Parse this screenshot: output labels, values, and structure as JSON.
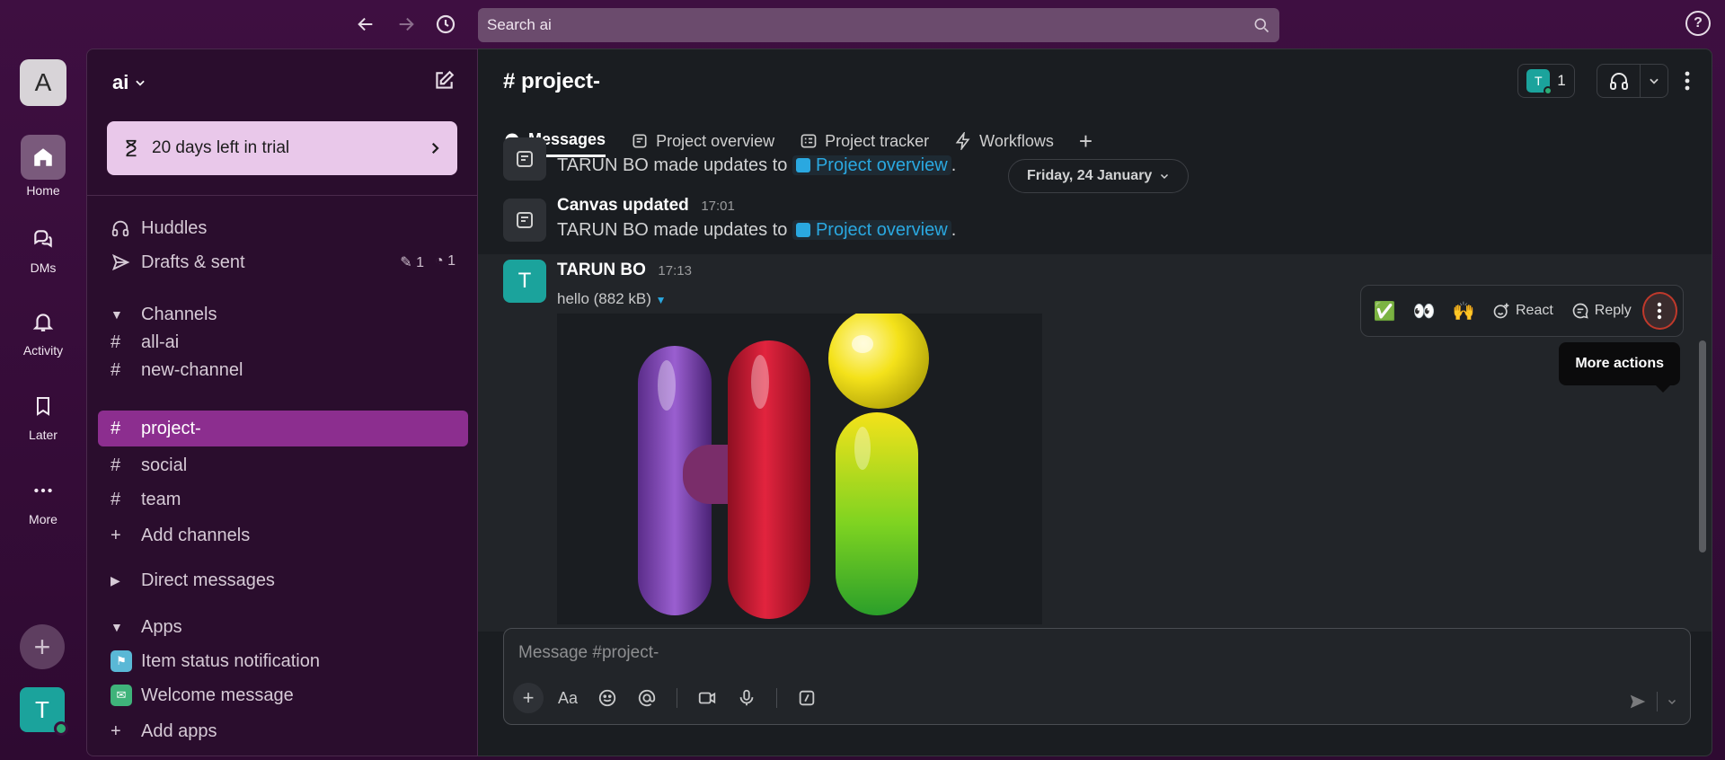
{
  "topbar": {
    "search_placeholder": "Search ai",
    "back_icon": "arrow-left-icon",
    "forward_icon": "arrow-right-icon",
    "history_icon": "clock-icon",
    "help_label": "?"
  },
  "rail": {
    "workspace_initial": "A",
    "items": [
      {
        "label": "Home",
        "icon": "home-icon"
      },
      {
        "label": "DMs",
        "icon": "dms-icon"
      },
      {
        "label": "Activity",
        "icon": "bell-icon"
      },
      {
        "label": "Later",
        "icon": "bookmark-icon"
      },
      {
        "label": "More",
        "icon": "more-icon"
      }
    ],
    "user_initial": "T"
  },
  "sidebar": {
    "workspace_name": "ai",
    "trial_text": "20 days left in trial",
    "huddles": "Huddles",
    "drafts": "Drafts & sent",
    "drafts_count": "1",
    "scheduled_count": "1",
    "channels_header": "Channels",
    "channels": [
      "all-ai",
      "new-channel",
      "project-",
      "social",
      "team"
    ],
    "active_channel": "project-",
    "add_channels": "Add channels",
    "dms_header": "Direct messages",
    "apps_header": "Apps",
    "apps": [
      {
        "name": "Item status notification",
        "color": "#5ab8d6"
      },
      {
        "name": "Welcome message",
        "color": "#3fb37a"
      }
    ],
    "add_apps": "Add apps"
  },
  "channel": {
    "title": "# project-",
    "member_initial": "T",
    "member_count": "1",
    "tabs": [
      {
        "label": "Messages",
        "active": true
      },
      {
        "label": "Project overview",
        "active": false
      },
      {
        "label": "Project tracker",
        "active": false
      },
      {
        "label": "Workflows",
        "active": false
      }
    ]
  },
  "messages": {
    "partial_text_prefix": "TARUN BO made updates to",
    "partial_link": "Project overview",
    "date_pill": "Friday, 24 January",
    "canvas_title": "Canvas updated",
    "canvas_time": "17:01",
    "canvas_text_prefix": "TARUN BO made updates to",
    "canvas_link": "Project overview",
    "user_name": "TARUN BO",
    "user_initial": "T",
    "user_time": "17:13",
    "file_meta": "hello (882 kB)"
  },
  "hover_actions": {
    "emojis": [
      "✅",
      "👀",
      "🙌"
    ],
    "react": "React",
    "reply": "Reply",
    "tooltip": "More actions"
  },
  "composer": {
    "placeholder": "Message #project-",
    "format_label": "Aa"
  }
}
